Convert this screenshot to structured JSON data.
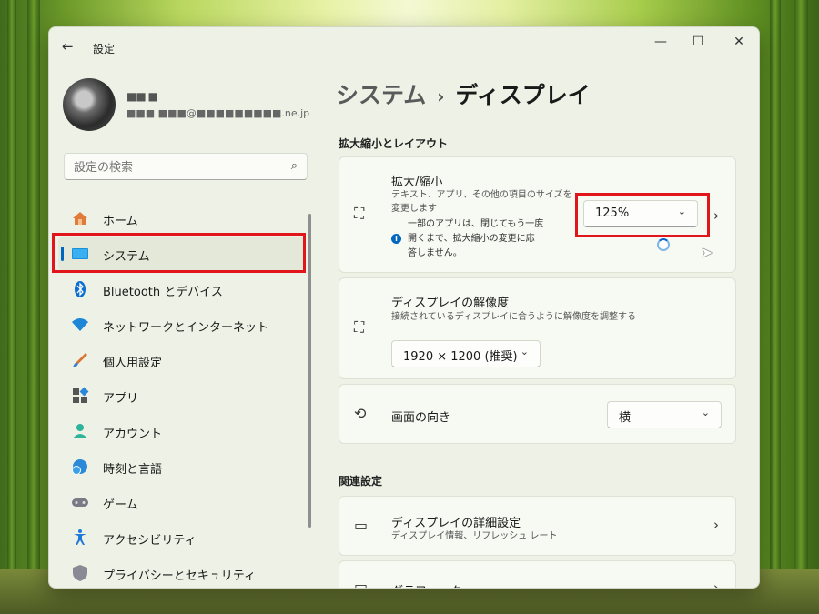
{
  "window": {
    "title": "設定",
    "controls": {
      "minimize": "—",
      "maximize": "☐",
      "close": "✕"
    }
  },
  "profile": {
    "name": "■■ ■",
    "email": "■■■ ■■■@■■■■■■■■■.ne.jp"
  },
  "search": {
    "placeholder": "設定の検索"
  },
  "sidebar": {
    "items": [
      {
        "label": "ホーム",
        "icon": "home-icon"
      },
      {
        "label": "システム",
        "icon": "system-monitor-icon",
        "active": true
      },
      {
        "label": "Bluetooth とデバイス",
        "icon": "bluetooth-icon"
      },
      {
        "label": "ネットワークとインターネット",
        "icon": "wifi-icon"
      },
      {
        "label": "個人用設定",
        "icon": "brush-icon"
      },
      {
        "label": "アプリ",
        "icon": "apps-icon"
      },
      {
        "label": "アカウント",
        "icon": "account-icon"
      },
      {
        "label": "時刻と言語",
        "icon": "time-language-icon"
      },
      {
        "label": "ゲーム",
        "icon": "gamepad-icon"
      },
      {
        "label": "アクセシビリティ",
        "icon": "accessibility-icon"
      },
      {
        "label": "プライバシーとセキュリティ",
        "icon": "shield-icon"
      }
    ]
  },
  "breadcrumb": {
    "parent": "システム",
    "separator": "›",
    "current": "ディスプレイ"
  },
  "sections": {
    "scale_layout": "拡大縮小とレイアウト",
    "related": "関連設定"
  },
  "scale": {
    "title": "拡大/縮小",
    "desc_line1": "テキスト、アプリ、その他の項目のサイズを",
    "desc_line2": "変更します",
    "note_line1": "一部のアプリは、閉じてもう一度",
    "note_line2": "開くまで、拡大縮小の変更に応",
    "note_line3": "答しません。",
    "value": "125%"
  },
  "resolution": {
    "title": "ディスプレイの解像度",
    "desc": "接続されているディスプレイに合うように解像度を調整する",
    "value": "1920 × 1200 (推奨)"
  },
  "orientation": {
    "title": "画面の向き",
    "value": "横"
  },
  "advanced": {
    "title": "ディスプレイの詳細設定",
    "desc": "ディスプレイ情報、リフレッシュ レート"
  },
  "graphics": {
    "title": "グラフィック"
  },
  "colors": {
    "accent": "#0067c0",
    "highlight": "#e0161b"
  }
}
